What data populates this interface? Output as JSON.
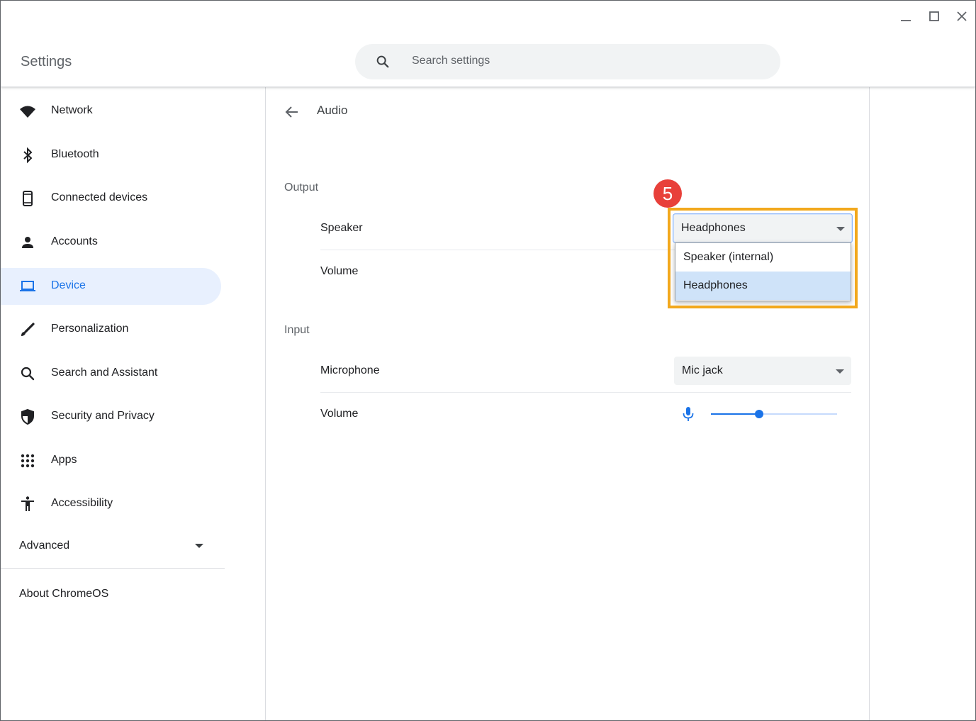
{
  "app": {
    "title": "Settings"
  },
  "search": {
    "placeholder": "Search settings"
  },
  "sidebar": {
    "items": [
      {
        "label": "Network",
        "icon": "wifi-icon"
      },
      {
        "label": "Bluetooth",
        "icon": "bluetooth-icon"
      },
      {
        "label": "Connected devices",
        "icon": "phone-icon"
      },
      {
        "label": "Accounts",
        "icon": "person-icon"
      },
      {
        "label": "Device",
        "icon": "laptop-icon",
        "active": true
      },
      {
        "label": "Personalization",
        "icon": "brush-icon"
      },
      {
        "label": "Search and Assistant",
        "icon": "search-icon"
      },
      {
        "label": "Security and Privacy",
        "icon": "shield-icon"
      },
      {
        "label": "Apps",
        "icon": "apps-grid-icon"
      },
      {
        "label": "Accessibility",
        "icon": "accessibility-icon"
      }
    ],
    "advanced_label": "Advanced",
    "about_label": "About ChromeOS"
  },
  "main": {
    "title": "Audio",
    "output": {
      "heading": "Output",
      "speaker_label": "Speaker",
      "speaker_value": "Headphones",
      "volume_label": "Volume",
      "dropdown_options": [
        "Speaker (internal)",
        "Headphones"
      ],
      "dropdown_selected": "Headphones"
    },
    "input": {
      "heading": "Input",
      "microphone_label": "Microphone",
      "microphone_value": "Mic jack",
      "volume_label": "Volume",
      "volume_level": 0.38
    }
  },
  "annotation": {
    "step_number": "5",
    "highlight_color": "#f2a81d",
    "badge_color": "#e8403a"
  },
  "colors": {
    "accent": "#1a73e8",
    "active_bg": "#e8f0fe"
  }
}
